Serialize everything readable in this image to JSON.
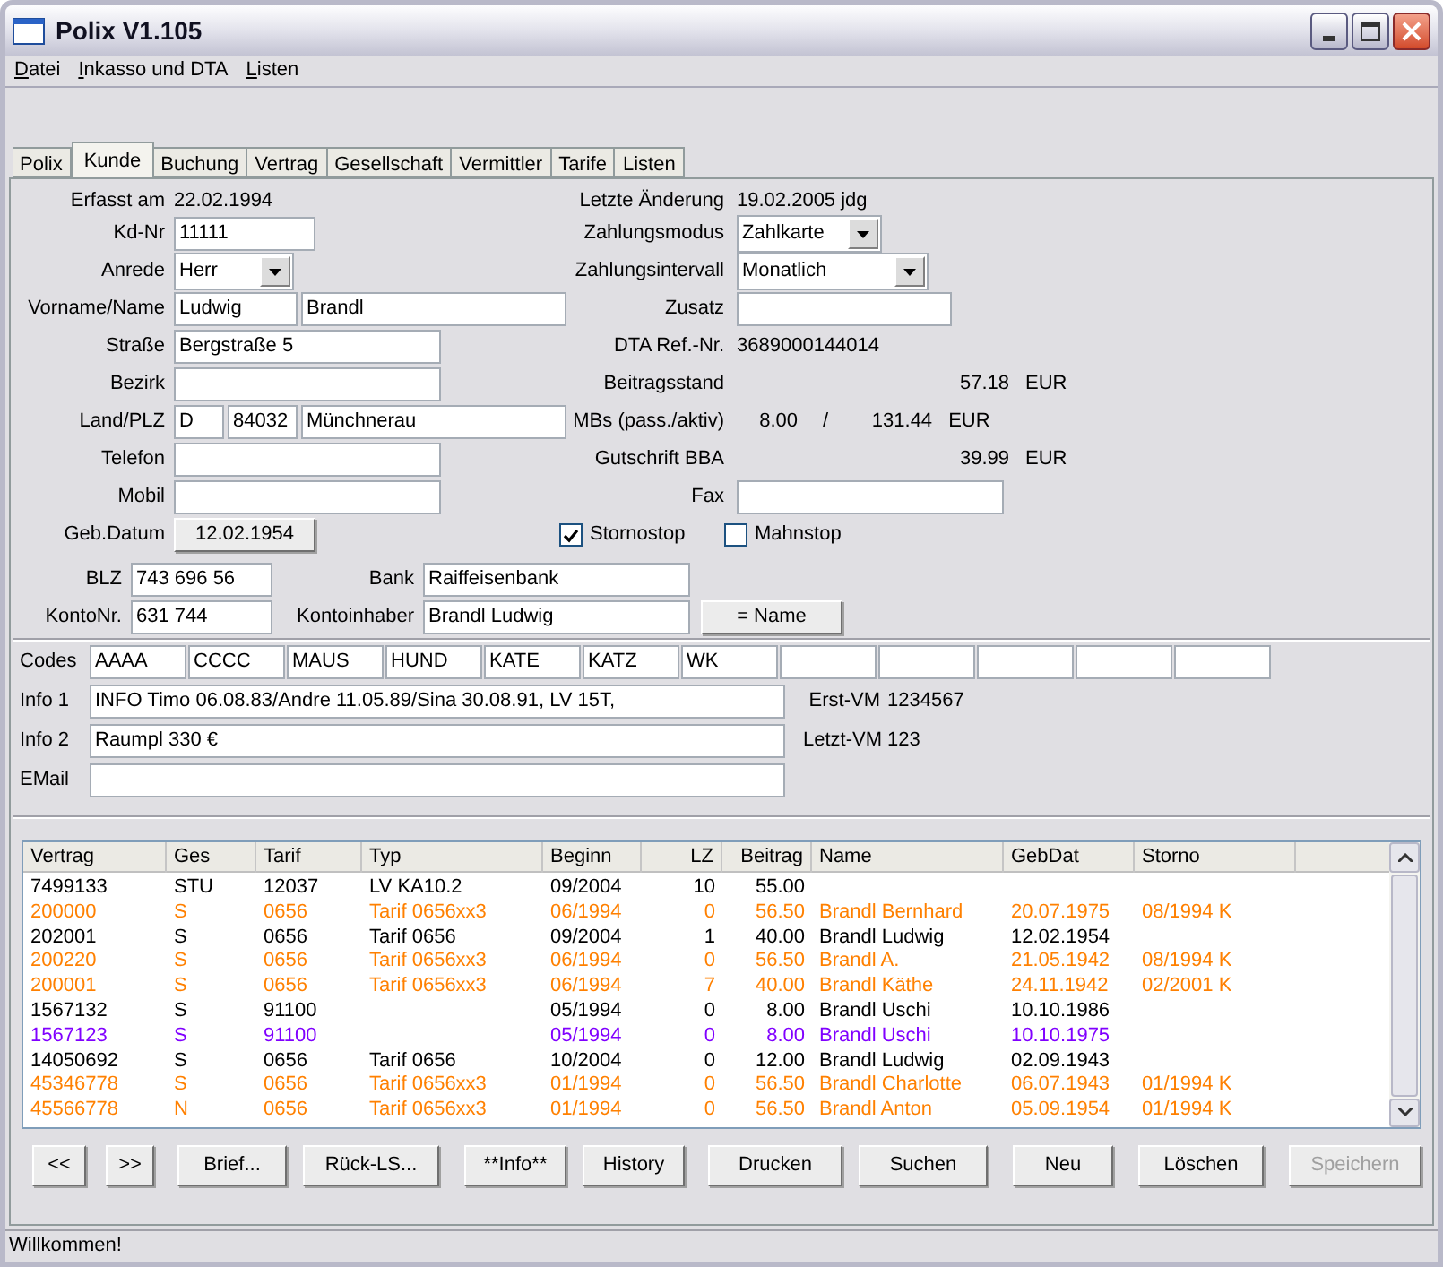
{
  "window": {
    "title": "Polix V1.105"
  },
  "menu": [
    "Datei",
    "Inkasso und DTA",
    "Listen"
  ],
  "tabs": [
    {
      "label": "Polix",
      "selected": false
    },
    {
      "label": "Kunde",
      "selected": true
    },
    {
      "label": "Buchung",
      "selected": false
    },
    {
      "label": "Vertrag",
      "selected": false
    },
    {
      "label": "Gesellschaft",
      "selected": false
    },
    {
      "label": "Vermittler",
      "selected": false
    },
    {
      "label": "Tarife",
      "selected": false
    },
    {
      "label": "Listen",
      "selected": false
    }
  ],
  "customer": {
    "erfasst_am": {
      "label": "Erfasst am",
      "value": "22.02.1994"
    },
    "kd_nr": {
      "label": "Kd-Nr",
      "value": "11111"
    },
    "anrede": {
      "label": "Anrede",
      "value": "Herr"
    },
    "vorname_name": {
      "label": "Vorname/Name",
      "first": "Ludwig",
      "last": "Brandl"
    },
    "strasse": {
      "label": "Straße",
      "value": "Bergstraße 5"
    },
    "bezirk": {
      "label": "Bezirk"
    },
    "land_plz": {
      "label": "Land/PLZ",
      "land": "D",
      "plz": "84032",
      "ort": "Münchnerau"
    },
    "telefon": {
      "label": "Telefon"
    },
    "mobil": {
      "label": "Mobil"
    },
    "geb_datum": {
      "label": "Geb.Datum",
      "value": "12.02.1954"
    },
    "letzte_aenderung": {
      "label": "Letzte Änderung",
      "value": "19.02.2005 jdg"
    },
    "zahlungsmodus": {
      "label": "Zahlungsmodus",
      "value": "Zahlkarte"
    },
    "zahlungsintervall": {
      "label": "Zahlungsintervall",
      "value": "Monatlich"
    },
    "zusatz": {
      "label": "Zusatz"
    },
    "dta_ref": {
      "label": "DTA Ref.-Nr.",
      "value": "3689000144014"
    },
    "beitragsstand": {
      "label": "Beitragsstand",
      "value": "57.18",
      "unit": "EUR"
    },
    "mbs": {
      "label": "MBs (pass./aktiv)",
      "passive": "8.00",
      "separator": "/",
      "active": "131.44",
      "unit": "EUR"
    },
    "gutschrift": {
      "label": "Gutschrift BBA",
      "value": "39.99",
      "unit": "EUR"
    },
    "fax": {
      "label": "Fax"
    },
    "stornostop": {
      "label": "Stornostop",
      "checked": true
    },
    "mahnstop": {
      "label": "Mahnstop",
      "checked": false
    },
    "blz": {
      "label": "BLZ",
      "value": "743 696 56"
    },
    "kontonr": {
      "label": "KontoNr.",
      "value": "631 744"
    },
    "bank": {
      "label": "Bank",
      "value": "Raiffeisenbank"
    },
    "kontoinhaber": {
      "label": "Kontoinhaber",
      "value": "Brandl Ludwig"
    },
    "name_button": "= Name",
    "codes": {
      "label": "Codes",
      "values": [
        "AAAA",
        "CCCC",
        "MAUS",
        "HUND",
        "KATE",
        "KATZ",
        "WK"
      ]
    },
    "info1": {
      "label": "Info 1",
      "value": "INFO Timo 06.08.83/Andre 11.05.89/Sina 30.08.91, LV 15T,"
    },
    "info2": {
      "label": "Info 2",
      "value": "Raumpl 330 €"
    },
    "email": {
      "label": "EMail"
    },
    "erst_vm": {
      "label": "Erst-VM",
      "value": "1234567"
    },
    "letzt_vm": {
      "label": "Letzt-VM",
      "value": "123"
    }
  },
  "table": {
    "columns": [
      "Vertrag",
      "Ges",
      "Tarif",
      "Typ",
      "Beginn",
      "LZ",
      "Beitrag",
      "Name",
      "GebDat",
      "Storno"
    ],
    "rows": [
      {
        "color": "#000000",
        "cells": [
          "7499133",
          "STU",
          "12037",
          "LV KA10.2",
          "09/2004",
          "10",
          "55.00",
          "",
          "",
          ""
        ]
      },
      {
        "color": "#ff8000",
        "cells": [
          "200000",
          "S",
          "0656",
          "Tarif 0656xx3",
          "06/1994",
          "0",
          "56.50",
          "Brandl Bernhard",
          "20.07.1975",
          "08/1994 K"
        ]
      },
      {
        "color": "#000000",
        "cells": [
          "202001",
          "S",
          "0656",
          "Tarif 0656",
          "09/2004",
          "1",
          "40.00",
          "Brandl Ludwig",
          "12.02.1954",
          ""
        ]
      },
      {
        "color": "#ff8000",
        "cells": [
          "200220",
          "S",
          "0656",
          "Tarif 0656xx3",
          "06/1994",
          "0",
          "56.50",
          "Brandl A.",
          "21.05.1942",
          "08/1994 K"
        ]
      },
      {
        "color": "#ff8000",
        "cells": [
          "200001",
          "S",
          "0656",
          "Tarif 0656xx3",
          "06/1994",
          "7",
          "40.00",
          "Brandl Käthe",
          "24.11.1942",
          "02/2001 K"
        ]
      },
      {
        "color": "#000000",
        "cells": [
          "1567132",
          "S",
          "91100",
          "",
          "05/1994",
          "0",
          "8.00",
          "Brandl Uschi",
          "10.10.1986",
          ""
        ]
      },
      {
        "color": "#8000ff",
        "cells": [
          "1567123",
          "S",
          "91100",
          "",
          "05/1994",
          "0",
          "8.00",
          "Brandl Uschi",
          "10.10.1975",
          ""
        ]
      },
      {
        "color": "#000000",
        "cells": [
          "14050692",
          "S",
          "0656",
          "Tarif 0656",
          "10/2004",
          "0",
          "12.00",
          "Brandl Ludwig",
          "02.09.1943",
          ""
        ]
      },
      {
        "color": "#ff8000",
        "cells": [
          "45346778",
          "S",
          "0656",
          "Tarif 0656xx3",
          "01/1994",
          "0",
          "56.50",
          "Brandl Charlotte",
          "06.07.1943",
          "01/1994 K"
        ]
      },
      {
        "color": "#ff8000",
        "cells": [
          "45566778",
          "N",
          "0656",
          "Tarif 0656xx3",
          "01/1994",
          "0",
          "56.50",
          "Brandl Anton",
          "05.09.1954",
          "01/1994 K"
        ]
      }
    ]
  },
  "buttons": [
    {
      "label": "<<",
      "disabled": false
    },
    {
      "label": ">>",
      "disabled": false
    },
    {
      "label": "Brief...",
      "disabled": false
    },
    {
      "label": "Rück-LS...",
      "disabled": false
    },
    {
      "label": "**Info**",
      "disabled": false
    },
    {
      "label": "History",
      "disabled": false
    },
    {
      "label": "Drucken",
      "disabled": false
    },
    {
      "label": "Suchen",
      "disabled": false
    },
    {
      "label": "Neu",
      "disabled": false
    },
    {
      "label": "Löschen",
      "disabled": false
    },
    {
      "label": "Speichern",
      "disabled": true
    }
  ],
  "status_bar": "Willkommen!"
}
